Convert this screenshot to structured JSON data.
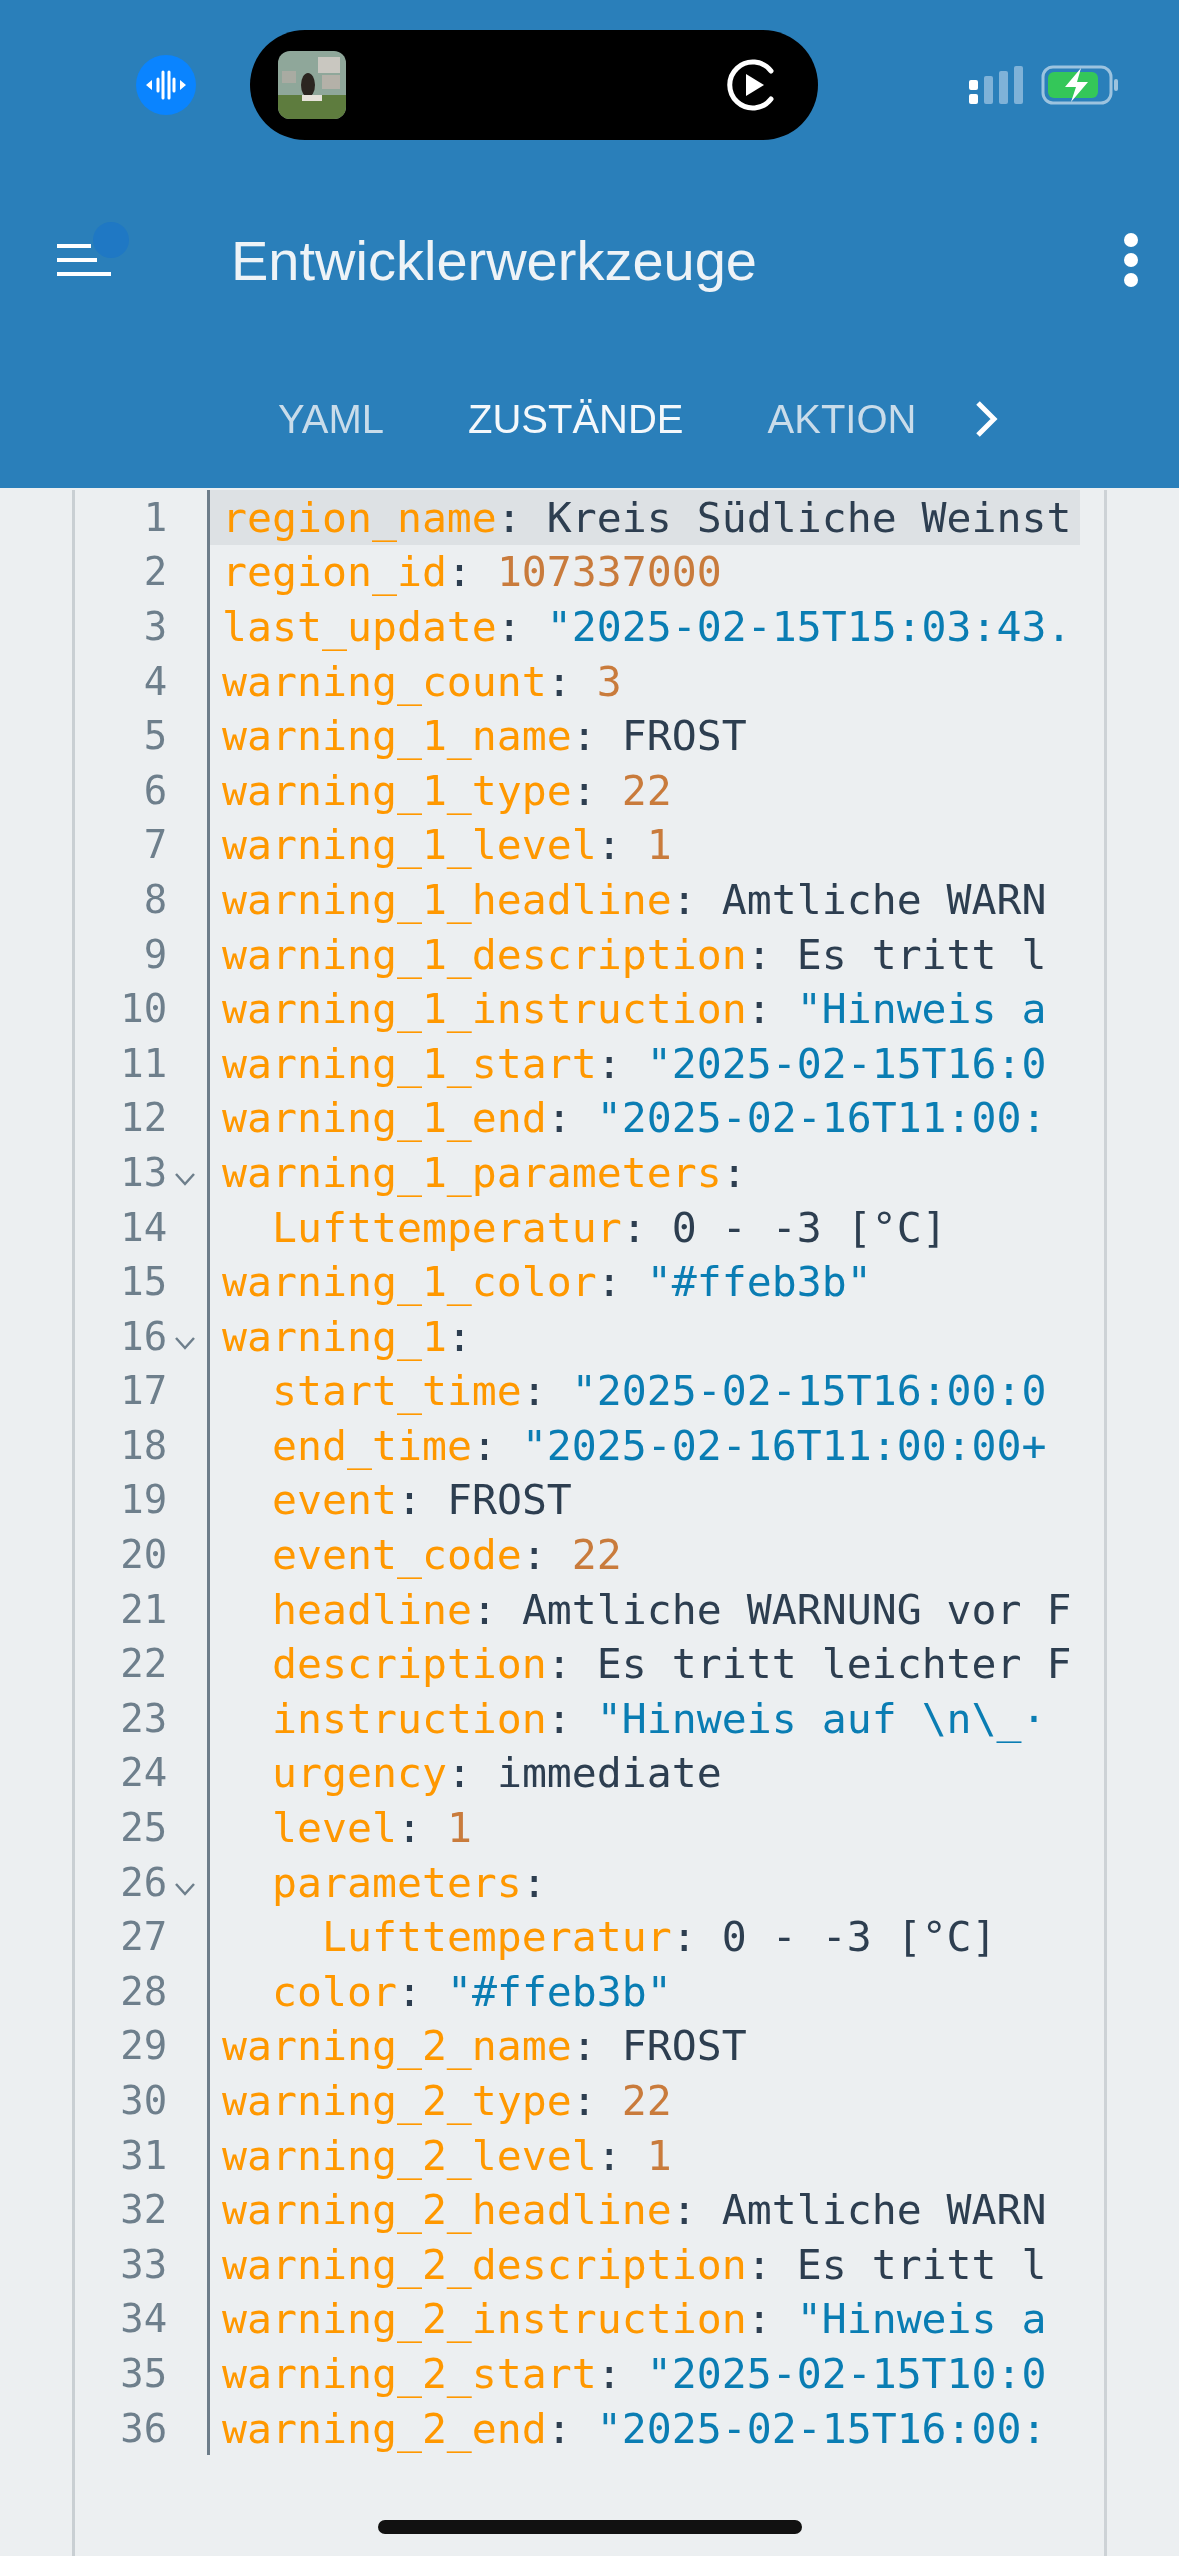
{
  "header": {
    "title": "Entwicklerwerkzeuge",
    "menu_badge": true
  },
  "tabs": [
    {
      "label": "YAML",
      "selected": false
    },
    {
      "label": "ZUSTÄNDE",
      "selected": true
    },
    {
      "label": "AKTION",
      "selected": false
    }
  ],
  "editor": {
    "lines": [
      {
        "n": "1",
        "key": "region_name",
        "colon": ":",
        "value": "Kreis Südliche Weinst",
        "kind": "plain",
        "active": true
      },
      {
        "n": "2",
        "key": "region_id",
        "colon": ":",
        "value": "107337000",
        "kind": "number",
        "active": false
      },
      {
        "n": "3",
        "key": "last_update",
        "colon": ":",
        "value": "\"2025-02-15T15:03:43.",
        "kind": "string",
        "active": false
      },
      {
        "n": "4",
        "key": "warning_count",
        "colon": ":",
        "value": "3",
        "kind": "number",
        "active": false
      },
      {
        "n": "5",
        "key": "warning_1_name",
        "colon": ":",
        "value": "FROST",
        "kind": "plain",
        "active": false
      },
      {
        "n": "6",
        "key": "warning_1_type",
        "colon": ":",
        "value": "22",
        "kind": "number",
        "active": false
      },
      {
        "n": "7",
        "key": "warning_1_level",
        "colon": ":",
        "value": "1",
        "kind": "number",
        "active": false
      },
      {
        "n": "8",
        "key": "warning_1_headline",
        "colon": ":",
        "value": "Amtliche WARN",
        "kind": "plain",
        "active": false
      },
      {
        "n": "9",
        "key": "warning_1_description",
        "colon": ":",
        "value": "Es tritt l",
        "kind": "plain",
        "active": false
      },
      {
        "n": "10",
        "key": "warning_1_instruction",
        "colon": ":",
        "value": "\"Hinweis a",
        "kind": "string",
        "active": false
      },
      {
        "n": "11",
        "key": "warning_1_start",
        "colon": ":",
        "value": "\"2025-02-15T16:0",
        "kind": "string",
        "active": false
      },
      {
        "n": "12",
        "key": "warning_1_end",
        "colon": ":",
        "value": "\"2025-02-16T11:00:",
        "kind": "string",
        "active": false
      },
      {
        "n": "13",
        "key": "warning_1_parameters",
        "colon": ":",
        "active": false,
        "children": [
          {
            "n": "14",
            "key": "Lufttemperatur",
            "colon": ":",
            "value": "0 - -3 [°C]",
            "kind": "plain",
            "active": false
          }
        ]
      },
      {
        "n": "15",
        "key": "warning_1_color",
        "colon": ":",
        "value": "\"#ffeb3b\"",
        "kind": "string",
        "active": false
      },
      {
        "n": "16",
        "key": "warning_1",
        "colon": ":",
        "active": false,
        "children": [
          {
            "n": "17",
            "key": "start_time",
            "colon": ":",
            "value": "\"2025-02-15T16:00:0",
            "kind": "string",
            "active": false
          },
          {
            "n": "18",
            "key": "end_time",
            "colon": ":",
            "value": "\"2025-02-16T11:00:00+",
            "kind": "string",
            "active": false
          },
          {
            "n": "19",
            "key": "event",
            "colon": ":",
            "value": "FROST",
            "kind": "plain",
            "active": false
          },
          {
            "n": "20",
            "key": "event_code",
            "colon": ":",
            "value": "22",
            "kind": "number",
            "active": false
          },
          {
            "n": "21",
            "key": "headline",
            "colon": ":",
            "value": "Amtliche WARNUNG vor F",
            "kind": "plain",
            "active": false
          },
          {
            "n": "22",
            "key": "description",
            "colon": ":",
            "value": "Es tritt leichter F",
            "kind": "plain",
            "active": false
          },
          {
            "n": "23",
            "key": "instruction",
            "colon": ":",
            "value": "\"Hinweis auf \\n\\_·",
            "kind": "string",
            "active": false
          },
          {
            "n": "24",
            "key": "urgency",
            "colon": ":",
            "value": "immediate",
            "kind": "plain",
            "active": false
          },
          {
            "n": "25",
            "key": "level",
            "colon": ":",
            "value": "1",
            "kind": "number",
            "active": false
          },
          {
            "n": "26",
            "key": "parameters",
            "colon": ":",
            "active": false,
            "children": [
              {
                "n": "27",
                "key": "Lufttemperatur",
                "colon": ":",
                "value": "0 - -3 [°C]",
                "kind": "plain",
                "active": false
              }
            ]
          },
          {
            "n": "28",
            "key": "color",
            "colon": ":",
            "value": "\"#ffeb3b\"",
            "kind": "string",
            "active": false
          }
        ]
      },
      {
        "n": "29",
        "key": "warning_2_name",
        "colon": ":",
        "value": "FROST",
        "kind": "plain",
        "active": false
      },
      {
        "n": "30",
        "key": "warning_2_type",
        "colon": ":",
        "value": "22",
        "kind": "number",
        "active": false
      },
      {
        "n": "31",
        "key": "warning_2_level",
        "colon": ":",
        "value": "1",
        "kind": "number",
        "active": false
      },
      {
        "n": "32",
        "key": "warning_2_headline",
        "colon": ":",
        "value": "Amtliche WARN",
        "kind": "plain",
        "active": false
      },
      {
        "n": "33",
        "key": "warning_2_description",
        "colon": ":",
        "value": "Es tritt l",
        "kind": "plain",
        "active": false
      },
      {
        "n": "34",
        "key": "warning_2_instruction",
        "colon": ":",
        "value": "\"Hinweis a",
        "kind": "string",
        "active": false
      },
      {
        "n": "35",
        "key": "warning_2_start",
        "colon": ":",
        "value": "\"2025-02-15T10:0",
        "kind": "string",
        "active": false
      },
      {
        "n": "36",
        "key": "warning_2_end",
        "colon": ":",
        "value": "\"2025-02-15T16:00:",
        "kind": "string",
        "active": false
      }
    ]
  }
}
